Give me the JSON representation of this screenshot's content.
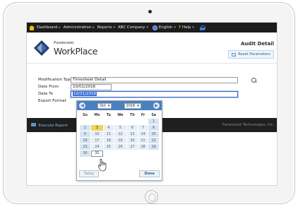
{
  "nav": {
    "items": [
      {
        "label": "Dashboard",
        "sep": "▸"
      },
      {
        "label": "Administration",
        "sep": "▸"
      },
      {
        "label": "Reports",
        "sep": "▾"
      },
      {
        "label": "ABC Company",
        "sep": "▾"
      },
      {
        "label": "English",
        "sep": "▾"
      },
      {
        "label": "Help",
        "sep": "▾"
      }
    ],
    "help_glyph": "?"
  },
  "brand": {
    "company": "Paramount",
    "product": "WorkPlace"
  },
  "page_title": "Audit Detail",
  "reset_label": "Reset Parameters",
  "form": {
    "fields": [
      {
        "label": "Modification Type",
        "value": "Timesheet Detail"
      },
      {
        "label": "Date From",
        "value": "10/01/2016"
      },
      {
        "label": "Date To",
        "value": "10/31/2016"
      },
      {
        "label": "Export Format",
        "value": ""
      }
    ]
  },
  "execute_label": "Execute Report",
  "footer_text": "Paramount Technologies, Inc.",
  "calendar": {
    "month": "Oct",
    "year": "2016",
    "prev_glyph": "◀",
    "next_glyph": "▶",
    "weekdays": [
      "Su",
      "Mo",
      "Tu",
      "We",
      "Th",
      "Fr",
      "Sa"
    ],
    "weeks": [
      [
        "",
        "",
        "",
        "",
        "",
        "",
        "1"
      ],
      [
        "2",
        "3",
        "4",
        "5",
        "6",
        "7",
        "8"
      ],
      [
        "9",
        "10",
        "11",
        "12",
        "13",
        "14",
        "15"
      ],
      [
        "16",
        "17",
        "18",
        "19",
        "20",
        "21",
        "22"
      ],
      [
        "23",
        "24",
        "25",
        "26",
        "27",
        "28",
        "29"
      ],
      [
        "30",
        "31",
        "",
        "",
        "",
        "",
        ""
      ]
    ],
    "today": "3",
    "selected": "31",
    "today_label": "Today",
    "done_label": "Done"
  },
  "colors": {
    "nav_bg": "#1c1c1c",
    "accent": "#4a7fc1",
    "today_highlight": "#f2d45a"
  }
}
